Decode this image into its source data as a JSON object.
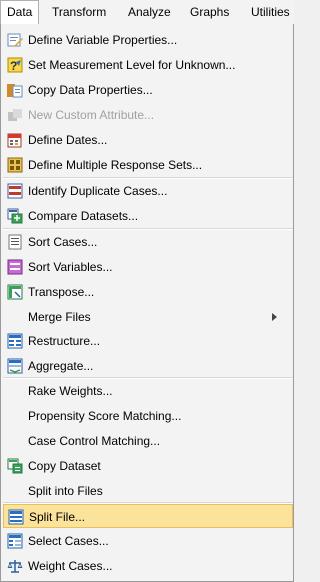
{
  "menubar": {
    "items": [
      "Data",
      "Transform",
      "Analyze",
      "Graphs",
      "Utilities"
    ]
  },
  "menu": {
    "items": [
      {
        "label": "Define Variable Properties...",
        "icon": "variable-properties-icon"
      },
      {
        "label": "Set Measurement Level for Unknown...",
        "icon": "measurement-level-icon"
      },
      {
        "label": "Copy Data Properties...",
        "icon": "copy-properties-icon"
      },
      {
        "label": "New Custom Attribute...",
        "icon": "custom-attribute-icon",
        "disabled": true
      },
      {
        "label": "Define Dates...",
        "icon": "calendar-icon"
      },
      {
        "label": "Define Multiple Response Sets...",
        "icon": "response-sets-icon"
      },
      {
        "label": "Identify Duplicate Cases...",
        "icon": "duplicate-cases-icon"
      },
      {
        "label": "Compare Datasets...",
        "icon": "compare-datasets-icon"
      },
      {
        "label": "Sort Cases...",
        "icon": "sort-cases-icon"
      },
      {
        "label": "Sort Variables...",
        "icon": "sort-variables-icon"
      },
      {
        "label": "Transpose...",
        "icon": "transpose-icon"
      },
      {
        "label": "Merge Files",
        "icon": "",
        "submenu": true
      },
      {
        "label": "Restructure...",
        "icon": "restructure-icon"
      },
      {
        "label": "Aggregate...",
        "icon": "aggregate-icon"
      },
      {
        "label": "Rake Weights...",
        "icon": ""
      },
      {
        "label": "Propensity Score Matching...",
        "icon": ""
      },
      {
        "label": "Case Control Matching...",
        "icon": ""
      },
      {
        "label": "Copy Dataset",
        "icon": "copy-dataset-icon"
      },
      {
        "label": "Split into Files",
        "icon": ""
      },
      {
        "label": "Split File...",
        "icon": "split-file-icon",
        "highlighted": true
      },
      {
        "label": "Select Cases...",
        "icon": "select-cases-icon"
      },
      {
        "label": "Weight Cases...",
        "icon": "weight-scale-icon"
      }
    ]
  }
}
